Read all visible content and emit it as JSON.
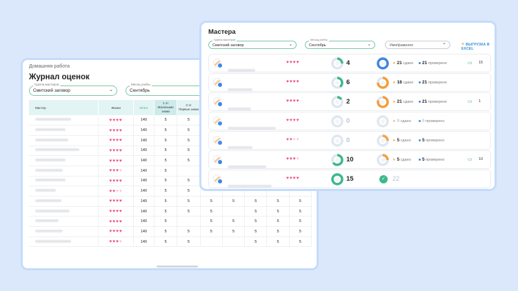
{
  "journal": {
    "breadcrumb": "Домашняя работа",
    "title": "Журнал оценок",
    "group_label": "Группа мастеров",
    "group_value": "Смитский заговор",
    "month_label": "Месяц учебы",
    "month_value": "Сентябрь",
    "columns": {
      "master": "Мастер",
      "lives": "Жизни",
      "total": "Итого",
      "sub1_num": "1 эт",
      "sub1_name": "Маленькие знаки",
      "sub2_num": "2 эт",
      "sub2_name": "Первые знаки"
    },
    "rows": [
      {
        "hearts_on": 4,
        "total": "140",
        "c1": "5",
        "c2": "5",
        "c3": "",
        "c4": "",
        "c5": "",
        "c6": "",
        "c7": ""
      },
      {
        "hearts_on": 4,
        "total": "140",
        "c1": "5",
        "c2": "5",
        "c3": "",
        "c4": "",
        "c5": "",
        "c6": "",
        "c7": ""
      },
      {
        "hearts_on": 4,
        "total": "140",
        "c1": "5",
        "c2": "5",
        "c3": "",
        "c4": "",
        "c5": "",
        "c6": "",
        "c7": ""
      },
      {
        "hearts_on": 4,
        "total": "140",
        "c1": "5",
        "c2": "5",
        "c3": "",
        "c4": "",
        "c5": "",
        "c6": "",
        "c7": ""
      },
      {
        "hearts_on": 4,
        "total": "140",
        "c1": "5",
        "c2": "5",
        "c3": "",
        "c4": "",
        "c5": "",
        "c6": "",
        "c7": ""
      },
      {
        "hearts_on": 3,
        "total": "140",
        "c1": "5",
        "c2": "",
        "c3": "",
        "c4": "",
        "c5": "",
        "c6": "",
        "c7": ""
      },
      {
        "hearts_on": 4,
        "total": "140",
        "c1": "5",
        "c2": "5",
        "c3": "",
        "c4": "",
        "c5": "",
        "c6": "",
        "c7": ""
      },
      {
        "hearts_on": 2,
        "total": "140",
        "c1": "5",
        "c2": "5",
        "c3": "",
        "c4": "",
        "c5": "",
        "c6": "",
        "c7": ""
      },
      {
        "hearts_on": 4,
        "total": "140",
        "c1": "5",
        "c2": "5",
        "c3": "5",
        "c4": "5",
        "c5": "5",
        "c6": "5",
        "c7": "5"
      },
      {
        "hearts_on": 4,
        "total": "140",
        "c1": "5",
        "c2": "5",
        "c3": "5",
        "c4": "",
        "c5": "5",
        "c6": "5",
        "c7": "5"
      },
      {
        "hearts_on": 4,
        "total": "140",
        "c1": "5",
        "c2": "",
        "c3": "5",
        "c4": "5",
        "c5": "5",
        "c6": "5",
        "c7": "5"
      },
      {
        "hearts_on": 4,
        "total": "140",
        "c1": "5",
        "c2": "5",
        "c3": "5",
        "c4": "5",
        "c5": "5",
        "c6": "5",
        "c7": "5"
      },
      {
        "hearts_on": 3,
        "total": "140",
        "c1": "5",
        "c2": "5",
        "c3": "",
        "c4": "",
        "c5": "5",
        "c6": "5",
        "c7": "5"
      }
    ]
  },
  "masters": {
    "title": "Мастера",
    "group_label": "Группа мастеров",
    "group_value": "Смитский заговор",
    "month_label": "Месяц учебы",
    "month_value": "Сентябрь",
    "search_placeholder": "Имя/фамилия",
    "excel_label": "ВЫГРУЗКА В EXCEL",
    "rows": [
      {
        "hearts_on": 4,
        "n1": "4",
        "frac1": 0.25,
        "a": "21",
        "a_label": "сдано",
        "b": "21",
        "b_label": "проверено",
        "frac2": 1.0,
        "msgs": "15",
        "zero": false,
        "done": false
      },
      {
        "hearts_on": 4,
        "n1": "6",
        "frac1": 0.4,
        "a": "18",
        "a_label": "сдано",
        "b": "21",
        "b_label": "проверено",
        "frac2": 0.75,
        "msgs": "",
        "zero": false,
        "done": false
      },
      {
        "hearts_on": 4,
        "n1": "2",
        "frac1": 0.15,
        "a": "21",
        "a_label": "сдано",
        "b": "21",
        "b_label": "проверено",
        "frac2": 0.8,
        "msgs": "1",
        "zero": false,
        "done": false
      },
      {
        "hearts_on": 4,
        "n1": "0",
        "frac1": 0,
        "a": "0",
        "a_label": "сдано",
        "b": "0",
        "b_label": "проверено",
        "frac2": 0,
        "msgs": "",
        "zero": true,
        "done": false
      },
      {
        "hearts_on": 2,
        "n1": "0",
        "frac1": 0,
        "a": "5",
        "a_label": "сдано",
        "b": "5",
        "b_label": "проверено",
        "frac2": 0.25,
        "msgs": "",
        "zero": true,
        "done": false
      },
      {
        "hearts_on": 3,
        "n1": "10",
        "frac1": 0.65,
        "a": "5",
        "a_label": "сдано",
        "b": "5",
        "b_label": "проверено",
        "frac2": 0.25,
        "msgs": "10",
        "zero": false,
        "done": false
      },
      {
        "hearts_on": 4,
        "n1": "15",
        "frac1": 1.0,
        "a": "",
        "a_label": "",
        "b": "",
        "b_label": "",
        "frac2": 1.0,
        "msgs": "",
        "zero": false,
        "done": true,
        "done_value": "22"
      }
    ]
  },
  "colors": {
    "teal": "#3cb98a",
    "blue": "#3d86e6",
    "orange": "#f59d3a",
    "heart": "#ee4c86"
  }
}
